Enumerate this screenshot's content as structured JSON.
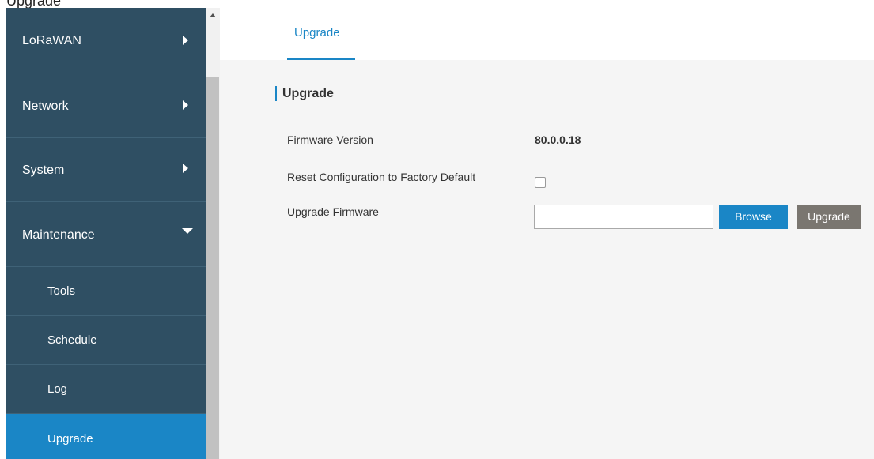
{
  "top_text": "Upgrade",
  "sidebar": {
    "items": [
      {
        "label": "LoRaWAN",
        "expanded": false
      },
      {
        "label": "Network",
        "expanded": false
      },
      {
        "label": "System",
        "expanded": false
      },
      {
        "label": "Maintenance",
        "expanded": true
      }
    ],
    "sub_items": [
      {
        "label": "Tools",
        "active": false
      },
      {
        "label": "Schedule",
        "active": false
      },
      {
        "label": "Log",
        "active": false
      },
      {
        "label": "Upgrade",
        "active": true
      }
    ]
  },
  "tabs": [
    {
      "label": "Upgrade",
      "active": true
    }
  ],
  "section": {
    "title": "Upgrade"
  },
  "fields": {
    "firmware_version_label": "Firmware Version",
    "firmware_version_value": "80.0.0.18",
    "reset_label": "Reset Configuration to Factory Default",
    "reset_checked": false,
    "upgrade_firmware_label": "Upgrade Firmware",
    "file_value": ""
  },
  "buttons": {
    "browse": "Browse",
    "upgrade": "Upgrade"
  },
  "colors": {
    "sidebar_bg": "#2f4f63",
    "active_item": "#1a86c6",
    "accent": "#1a86c6",
    "upgrade_button": "#7a7670",
    "content_bg": "#f5f5f5"
  }
}
